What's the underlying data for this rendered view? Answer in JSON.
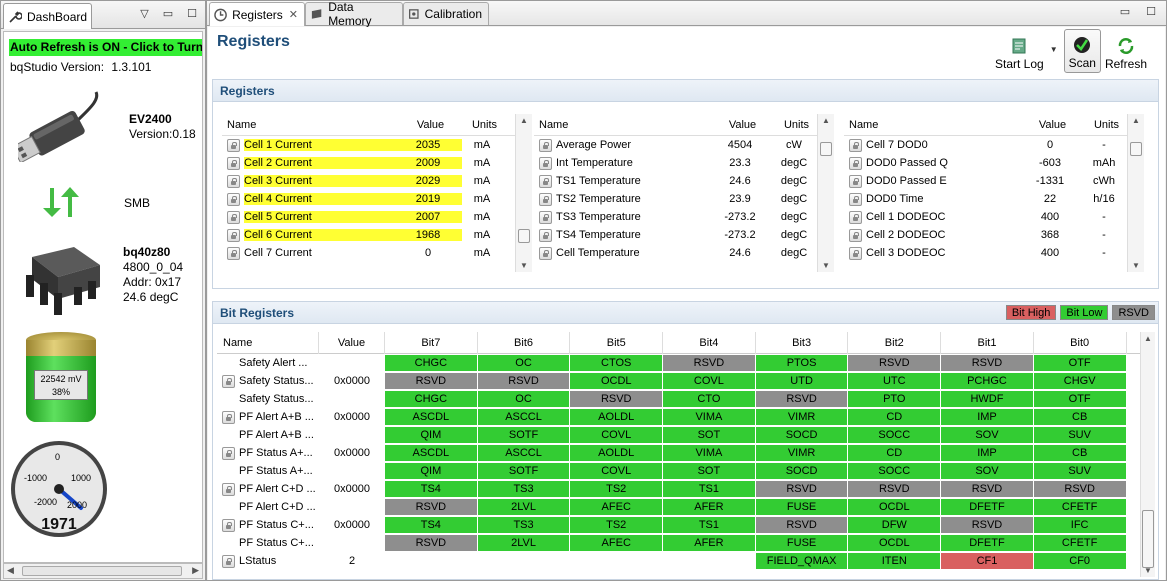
{
  "dashboard": {
    "tab_label": "DashBoard",
    "auto_refresh": "Auto Refresh is ON - Click to Turn",
    "version_label": "bqStudio Version:",
    "version_value": "1.3.101",
    "adapter": {
      "name": "EV2400",
      "version": "Version:0.18"
    },
    "bus": "SMB",
    "device": {
      "name": "bq40z80",
      "fw": "4800_0_04",
      "addr": "Addr: 0x17",
      "temp": "24.6 degC"
    },
    "battery": {
      "voltage": "22542 mV",
      "percent": "38%",
      "fill_fraction": 0.38
    },
    "gauge": {
      "value": "1971",
      "tick_minus_1000": "-1000",
      "tick_0": "0",
      "tick_1000": "1000",
      "tick_minus_2000": "-2000",
      "tick_2000": "2000"
    }
  },
  "tabs": [
    {
      "label": "Registers",
      "active": true,
      "closable": true
    },
    {
      "label": "Data Memory",
      "active": false
    },
    {
      "label": "Calibration",
      "active": false
    }
  ],
  "page_title": "Registers",
  "toolbar": {
    "start_log": "Start Log",
    "scan": "Scan",
    "refresh": "Refresh"
  },
  "registers_section": {
    "title": "Registers",
    "headers": {
      "name": "Name",
      "value": "Value",
      "units": "Units"
    },
    "tables": [
      [
        {
          "name": "Cell 1 Current",
          "value": "2035",
          "units": "mA",
          "highlight": true
        },
        {
          "name": "Cell 2 Current",
          "value": "2009",
          "units": "mA",
          "highlight": true
        },
        {
          "name": "Cell 3 Current",
          "value": "2029",
          "units": "mA",
          "highlight": true
        },
        {
          "name": "Cell 4 Current",
          "value": "2019",
          "units": "mA",
          "highlight": true
        },
        {
          "name": "Cell 5 Current",
          "value": "2007",
          "units": "mA",
          "highlight": true
        },
        {
          "name": "Cell 6 Current",
          "value": "1968",
          "units": "mA",
          "highlight": true
        },
        {
          "name": "Cell 7 Current",
          "value": "0",
          "units": "mA",
          "highlight": false
        }
      ],
      [
        {
          "name": "Average Power",
          "value": "4504",
          "units": "cW"
        },
        {
          "name": "Int Temperature",
          "value": "23.3",
          "units": "degC"
        },
        {
          "name": "TS1 Temperature",
          "value": "24.6",
          "units": "degC"
        },
        {
          "name": "TS2 Temperature",
          "value": "23.9",
          "units": "degC"
        },
        {
          "name": "TS3 Temperature",
          "value": "-273.2",
          "units": "degC"
        },
        {
          "name": "TS4 Temperature",
          "value": "-273.2",
          "units": "degC"
        },
        {
          "name": "Cell Temperature",
          "value": "24.6",
          "units": "degC"
        }
      ],
      [
        {
          "name": "Cell 7 DOD0",
          "value": "0",
          "units": "-"
        },
        {
          "name": "DOD0 Passed Q",
          "value": "-603",
          "units": "mAh"
        },
        {
          "name": "DOD0 Passed E",
          "value": "-1331",
          "units": "cWh"
        },
        {
          "name": "DOD0 Time",
          "value": "22",
          "units": "h/16"
        },
        {
          "name": "Cell 1 DODEOC",
          "value": "400",
          "units": "-"
        },
        {
          "name": "Cell 2 DODEOC",
          "value": "368",
          "units": "-"
        },
        {
          "name": "Cell 3 DODEOC",
          "value": "400",
          "units": "-"
        }
      ]
    ]
  },
  "bit_section": {
    "title": "Bit Registers",
    "legend": {
      "high": "Bit High",
      "low": "Bit Low",
      "rsvd": "RSVD"
    },
    "colors": {
      "high": "#d96060",
      "low": "#33cc33",
      "rsvd": "#8e8e8e"
    },
    "headers": [
      "Name",
      "Value",
      "Bit7",
      "Bit6",
      "Bit5",
      "Bit4",
      "Bit3",
      "Bit2",
      "Bit1",
      "Bit0"
    ],
    "rows": [
      {
        "name": "Safety Alert ...",
        "lock": false,
        "value": "",
        "bits": [
          [
            "CHGC",
            "g"
          ],
          [
            "OC",
            "g"
          ],
          [
            "CTOS",
            "g"
          ],
          [
            "RSVD",
            "s"
          ],
          [
            "PTOS",
            "g"
          ],
          [
            "RSVD",
            "s"
          ],
          [
            "RSVD",
            "s"
          ],
          [
            "OTF",
            "g"
          ]
        ]
      },
      {
        "name": "Safety Status...",
        "lock": true,
        "value": "0x0000",
        "bits": [
          [
            "RSVD",
            "s"
          ],
          [
            "RSVD",
            "s"
          ],
          [
            "OCDL",
            "g"
          ],
          [
            "COVL",
            "g"
          ],
          [
            "UTD",
            "g"
          ],
          [
            "UTC",
            "g"
          ],
          [
            "PCHGC",
            "g"
          ],
          [
            "CHGV",
            "g"
          ]
        ]
      },
      {
        "name": "Safety Status...",
        "lock": false,
        "value": "",
        "bits": [
          [
            "CHGC",
            "g"
          ],
          [
            "OC",
            "g"
          ],
          [
            "RSVD",
            "s"
          ],
          [
            "CTO",
            "g"
          ],
          [
            "RSVD",
            "s"
          ],
          [
            "PTO",
            "g"
          ],
          [
            "HWDF",
            "g"
          ],
          [
            "OTF",
            "g"
          ]
        ]
      },
      {
        "name": "PF Alert A+B ...",
        "lock": true,
        "value": "0x0000",
        "bits": [
          [
            "ASCDL",
            "g"
          ],
          [
            "ASCCL",
            "g"
          ],
          [
            "AOLDL",
            "g"
          ],
          [
            "VIMA",
            "g"
          ],
          [
            "VIMR",
            "g"
          ],
          [
            "CD",
            "g"
          ],
          [
            "IMP",
            "g"
          ],
          [
            "CB",
            "g"
          ]
        ]
      },
      {
        "name": "PF Alert A+B ...",
        "lock": false,
        "value": "",
        "bits": [
          [
            "QIM",
            "g"
          ],
          [
            "SOTF",
            "g"
          ],
          [
            "COVL",
            "g"
          ],
          [
            "SOT",
            "g"
          ],
          [
            "SOCD",
            "g"
          ],
          [
            "SOCC",
            "g"
          ],
          [
            "SOV",
            "g"
          ],
          [
            "SUV",
            "g"
          ]
        ]
      },
      {
        "name": "PF Status A+...",
        "lock": true,
        "value": "0x0000",
        "bits": [
          [
            "ASCDL",
            "g"
          ],
          [
            "ASCCL",
            "g"
          ],
          [
            "AOLDL",
            "g"
          ],
          [
            "VIMA",
            "g"
          ],
          [
            "VIMR",
            "g"
          ],
          [
            "CD",
            "g"
          ],
          [
            "IMP",
            "g"
          ],
          [
            "CB",
            "g"
          ]
        ]
      },
      {
        "name": "PF Status A+...",
        "lock": false,
        "value": "",
        "bits": [
          [
            "QIM",
            "g"
          ],
          [
            "SOTF",
            "g"
          ],
          [
            "COVL",
            "g"
          ],
          [
            "SOT",
            "g"
          ],
          [
            "SOCD",
            "g"
          ],
          [
            "SOCC",
            "g"
          ],
          [
            "SOV",
            "g"
          ],
          [
            "SUV",
            "g"
          ]
        ]
      },
      {
        "name": "PF Alert C+D ...",
        "lock": true,
        "value": "0x0000",
        "bits": [
          [
            "TS4",
            "g"
          ],
          [
            "TS3",
            "g"
          ],
          [
            "TS2",
            "g"
          ],
          [
            "TS1",
            "g"
          ],
          [
            "RSVD",
            "s"
          ],
          [
            "RSVD",
            "s"
          ],
          [
            "RSVD",
            "s"
          ],
          [
            "RSVD",
            "s"
          ]
        ]
      },
      {
        "name": "PF Alert C+D ...",
        "lock": false,
        "value": "",
        "bits": [
          [
            "RSVD",
            "s"
          ],
          [
            "2LVL",
            "g"
          ],
          [
            "AFEC",
            "g"
          ],
          [
            "AFER",
            "g"
          ],
          [
            "FUSE",
            "g"
          ],
          [
            "OCDL",
            "g"
          ],
          [
            "DFETF",
            "g"
          ],
          [
            "CFETF",
            "g"
          ]
        ]
      },
      {
        "name": "PF Status C+...",
        "lock": true,
        "value": "0x0000",
        "bits": [
          [
            "TS4",
            "g"
          ],
          [
            "TS3",
            "g"
          ],
          [
            "TS2",
            "g"
          ],
          [
            "TS1",
            "g"
          ],
          [
            "RSVD",
            "s"
          ],
          [
            "DFW",
            "g"
          ],
          [
            "RSVD",
            "s"
          ],
          [
            "IFC",
            "g"
          ]
        ]
      },
      {
        "name": "PF Status C+...",
        "lock": false,
        "value": "",
        "bits": [
          [
            "RSVD",
            "s"
          ],
          [
            "2LVL",
            "g"
          ],
          [
            "AFEC",
            "g"
          ],
          [
            "AFER",
            "g"
          ],
          [
            "FUSE",
            "g"
          ],
          [
            "OCDL",
            "g"
          ],
          [
            "DFETF",
            "g"
          ],
          [
            "CFETF",
            "g"
          ]
        ]
      },
      {
        "name": "LStatus",
        "lock": true,
        "value": "2",
        "bits": [
          [
            "",
            "e"
          ],
          [
            "",
            "e"
          ],
          [
            "",
            "e"
          ],
          [
            "",
            "e"
          ],
          [
            "FIELD_QMAX",
            "g"
          ],
          [
            "ITEN",
            "g"
          ],
          [
            "CF1",
            "r"
          ],
          [
            "CF0",
            "g"
          ]
        ]
      }
    ]
  }
}
